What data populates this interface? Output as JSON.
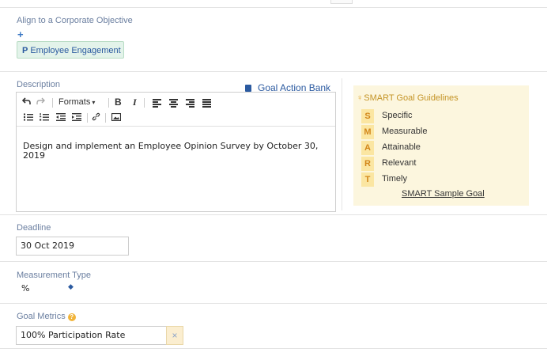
{
  "objective": {
    "label": "Align to a Corporate Objective",
    "add_symbol": "+",
    "tag_icon": "P",
    "tag": "Employee Engagement"
  },
  "description": {
    "label": "Description",
    "action_bank": "Goal Action Bank",
    "toolbar": {
      "formats": "Formats",
      "bold": "B",
      "italic": "I"
    },
    "text": "Design and implement an Employee Opinion Survey by October 30, 2019"
  },
  "smart": {
    "title": "SMART Goal Guidelines",
    "items": [
      {
        "letter": "S",
        "word": "Specific"
      },
      {
        "letter": "M",
        "word": "Measurable"
      },
      {
        "letter": "A",
        "word": "Attainable"
      },
      {
        "letter": "R",
        "word": "Relevant"
      },
      {
        "letter": "T",
        "word": "Timely"
      }
    ],
    "sample_link": "SMART Sample Goal"
  },
  "deadline": {
    "label": "Deadline",
    "value": "30 Oct 2019"
  },
  "measurement": {
    "label": "Measurement Type",
    "value": "%"
  },
  "metrics": {
    "label": "Goal Metrics",
    "value": "100% Participation Rate",
    "clear_symbol": "×"
  },
  "colors": {
    "accent": "#2b5aa0",
    "tag_bg": "#e3f3ea",
    "smart_bg": "#fcf6de",
    "smart_letter": "#d2871a"
  }
}
